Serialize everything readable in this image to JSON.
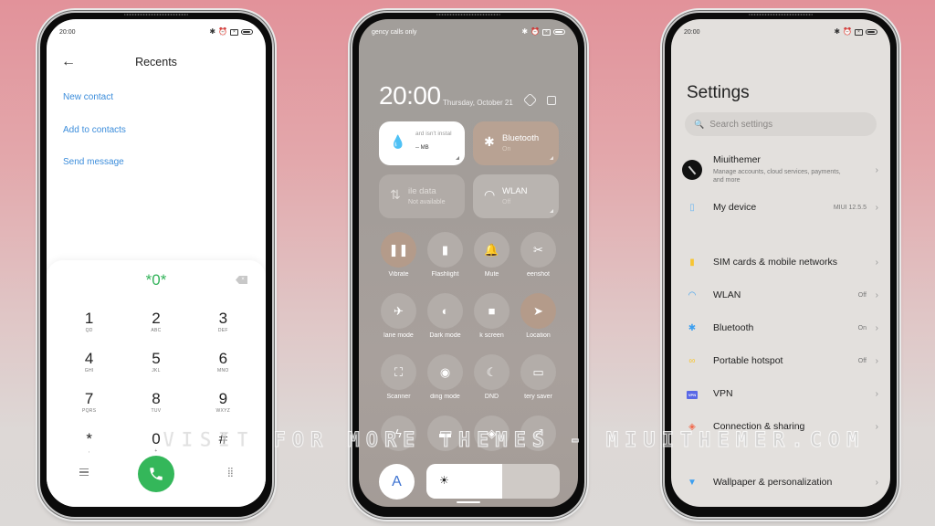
{
  "phones": {
    "dialer": {
      "status_time": "20:00",
      "title": "Recents",
      "actions": [
        "New contact",
        "Add to contacts",
        "Send message"
      ],
      "dialed_number": "*0*",
      "keys": [
        {
          "digit": "1",
          "letters": "QD"
        },
        {
          "digit": "2",
          "letters": "ABC"
        },
        {
          "digit": "3",
          "letters": "DEF"
        },
        {
          "digit": "4",
          "letters": "GHI"
        },
        {
          "digit": "5",
          "letters": "JKL"
        },
        {
          "digit": "6",
          "letters": "MNO"
        },
        {
          "digit": "7",
          "letters": "PQRS"
        },
        {
          "digit": "8",
          "letters": "TUV"
        },
        {
          "digit": "9",
          "letters": "WXYZ"
        },
        {
          "digit": "*",
          "letters": ","
        },
        {
          "digit": "0",
          "letters": "+"
        },
        {
          "digit": "#",
          "letters": ""
        }
      ],
      "accent_color": "#34b75a"
    },
    "control_center": {
      "status_text": "gency calls only",
      "time": "20:00",
      "date": "Thursday, October 21",
      "tiles": {
        "data": {
          "title": "ard isn't instal",
          "subtitle": "-- MB"
        },
        "bluetooth": {
          "title": "Bluetooth",
          "subtitle": "On"
        },
        "mobile_data": {
          "title": "ile data",
          "subtitle": "Not available"
        },
        "wlan": {
          "title": "WLAN",
          "subtitle": "Off"
        }
      },
      "toggles": [
        {
          "label": "Vibrate",
          "icon": "vibrate-icon",
          "glyph": "❚❚",
          "on": true
        },
        {
          "label": "Flashlight",
          "icon": "flashlight-icon",
          "glyph": "▮",
          "on": false
        },
        {
          "label": "Mute",
          "icon": "bell-icon",
          "glyph": "🔔",
          "on": false
        },
        {
          "label": "eenshot",
          "icon": "screenshot-icon",
          "glyph": "✂",
          "on": false
        },
        {
          "label": "lane mode",
          "icon": "airplane-icon",
          "glyph": "✈",
          "on": false
        },
        {
          "label": "Dark mode",
          "icon": "dark-mode-icon",
          "glyph": "◐",
          "on": false
        },
        {
          "label": "k screen",
          "icon": "lock-icon",
          "glyph": "■",
          "on": false
        },
        {
          "label": "Location",
          "icon": "location-icon",
          "glyph": "➤",
          "on": true
        },
        {
          "label": "Scanner",
          "icon": "scanner-icon",
          "glyph": "⛶",
          "on": false
        },
        {
          "label": "ding mode",
          "icon": "eye-icon",
          "glyph": "◉",
          "on": false
        },
        {
          "label": "DND",
          "icon": "moon-icon",
          "glyph": "☾",
          "on": false
        },
        {
          "label": "tery saver",
          "icon": "battery-saver-icon",
          "glyph": "▭",
          "on": false
        },
        {
          "label": "",
          "icon": "flash-icon",
          "glyph": "ϟ",
          "on": false
        },
        {
          "label": "",
          "icon": "cast-icon",
          "glyph": "▬",
          "on": false
        },
        {
          "label": "",
          "icon": "nfc-icon",
          "glyph": "◈",
          "on": false
        },
        {
          "label": "",
          "icon": "rotate-icon",
          "glyph": "⤢",
          "on": false
        }
      ],
      "auto_brightness_label": "A",
      "brightness_percent": 57
    },
    "settings": {
      "status_time": "20:00",
      "title": "Settings",
      "search_placeholder": "Search settings",
      "account": {
        "name": "Miuithemer",
        "subtitle": "Manage accounts, cloud services, payments, and more"
      },
      "items": [
        {
          "label": "My device",
          "value": "MIUI 12.5.5",
          "icon": "device-icon",
          "color": "#6fb7f0"
        },
        {
          "label": "SIM cards & mobile networks",
          "value": "",
          "icon": "sim-icon",
          "color": "#f7c531"
        },
        {
          "label": "WLAN",
          "value": "Off",
          "icon": "wifi-icon",
          "color": "#3c9ff0"
        },
        {
          "label": "Bluetooth",
          "value": "On",
          "icon": "bluetooth-icon",
          "color": "#3c9ff0"
        },
        {
          "label": "Portable hotspot",
          "value": "Off",
          "icon": "hotspot-icon",
          "color": "#f7c531"
        },
        {
          "label": "VPN",
          "value": "",
          "icon": "vpn-icon",
          "color": "#5968e6"
        },
        {
          "label": "Connection & sharing",
          "value": "",
          "icon": "connection-icon",
          "color": "#f06a4d"
        },
        {
          "label": "Wallpaper & personalization",
          "value": "",
          "icon": "wallpaper-icon",
          "color": "#3c9ff0"
        }
      ]
    }
  },
  "watermark": "VISIT FOR MORE THEMES - MIUITHEMER.COM"
}
